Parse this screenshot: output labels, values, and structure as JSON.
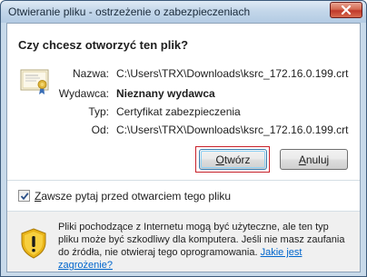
{
  "window": {
    "title": "Otwieranie pliku - ostrzeżenie o zabezpieczeniach"
  },
  "dialog": {
    "question": "Czy chcesz otworzyć ten plik?",
    "fields": {
      "name_label": "Nazwa:",
      "name_value": "C:\\Users\\TRX\\Downloads\\ksrc_172.16.0.199.crt",
      "publisher_label": "Wydawca:",
      "publisher_value": "Nieznany wydawca",
      "type_label": "Typ:",
      "type_value": "Certyfikat zabezpieczenia",
      "from_label": "Od:",
      "from_value": "C:\\Users\\TRX\\Downloads\\ksrc_172.16.0.199.crt"
    },
    "buttons": {
      "open": {
        "mnemonic": "O",
        "rest": "twórz"
      },
      "cancel": {
        "mnemonic": "A",
        "rest": "nuluj"
      }
    },
    "checkbox": {
      "mnemonic": "Z",
      "rest": "awsze pytaj przed otwarciem tego pliku",
      "checked": true
    },
    "footer": {
      "text": "Pliki pochodzące z Internetu mogą być użyteczne, ale ten typ pliku może być szkodliwy dla komputera. Jeśli nie masz zaufania do źródła, nie otwieraj tego oprogramowania.",
      "link": "Jakie jest zagrożenie?"
    }
  },
  "colors": {
    "link": "#0066cc",
    "focus_border": "#c8202a",
    "footer_bg": "#f0f0f0"
  },
  "icons": {
    "close": "close-icon",
    "file": "certificate-icon",
    "warning": "shield-warning-icon",
    "check": "checkmark-icon"
  }
}
